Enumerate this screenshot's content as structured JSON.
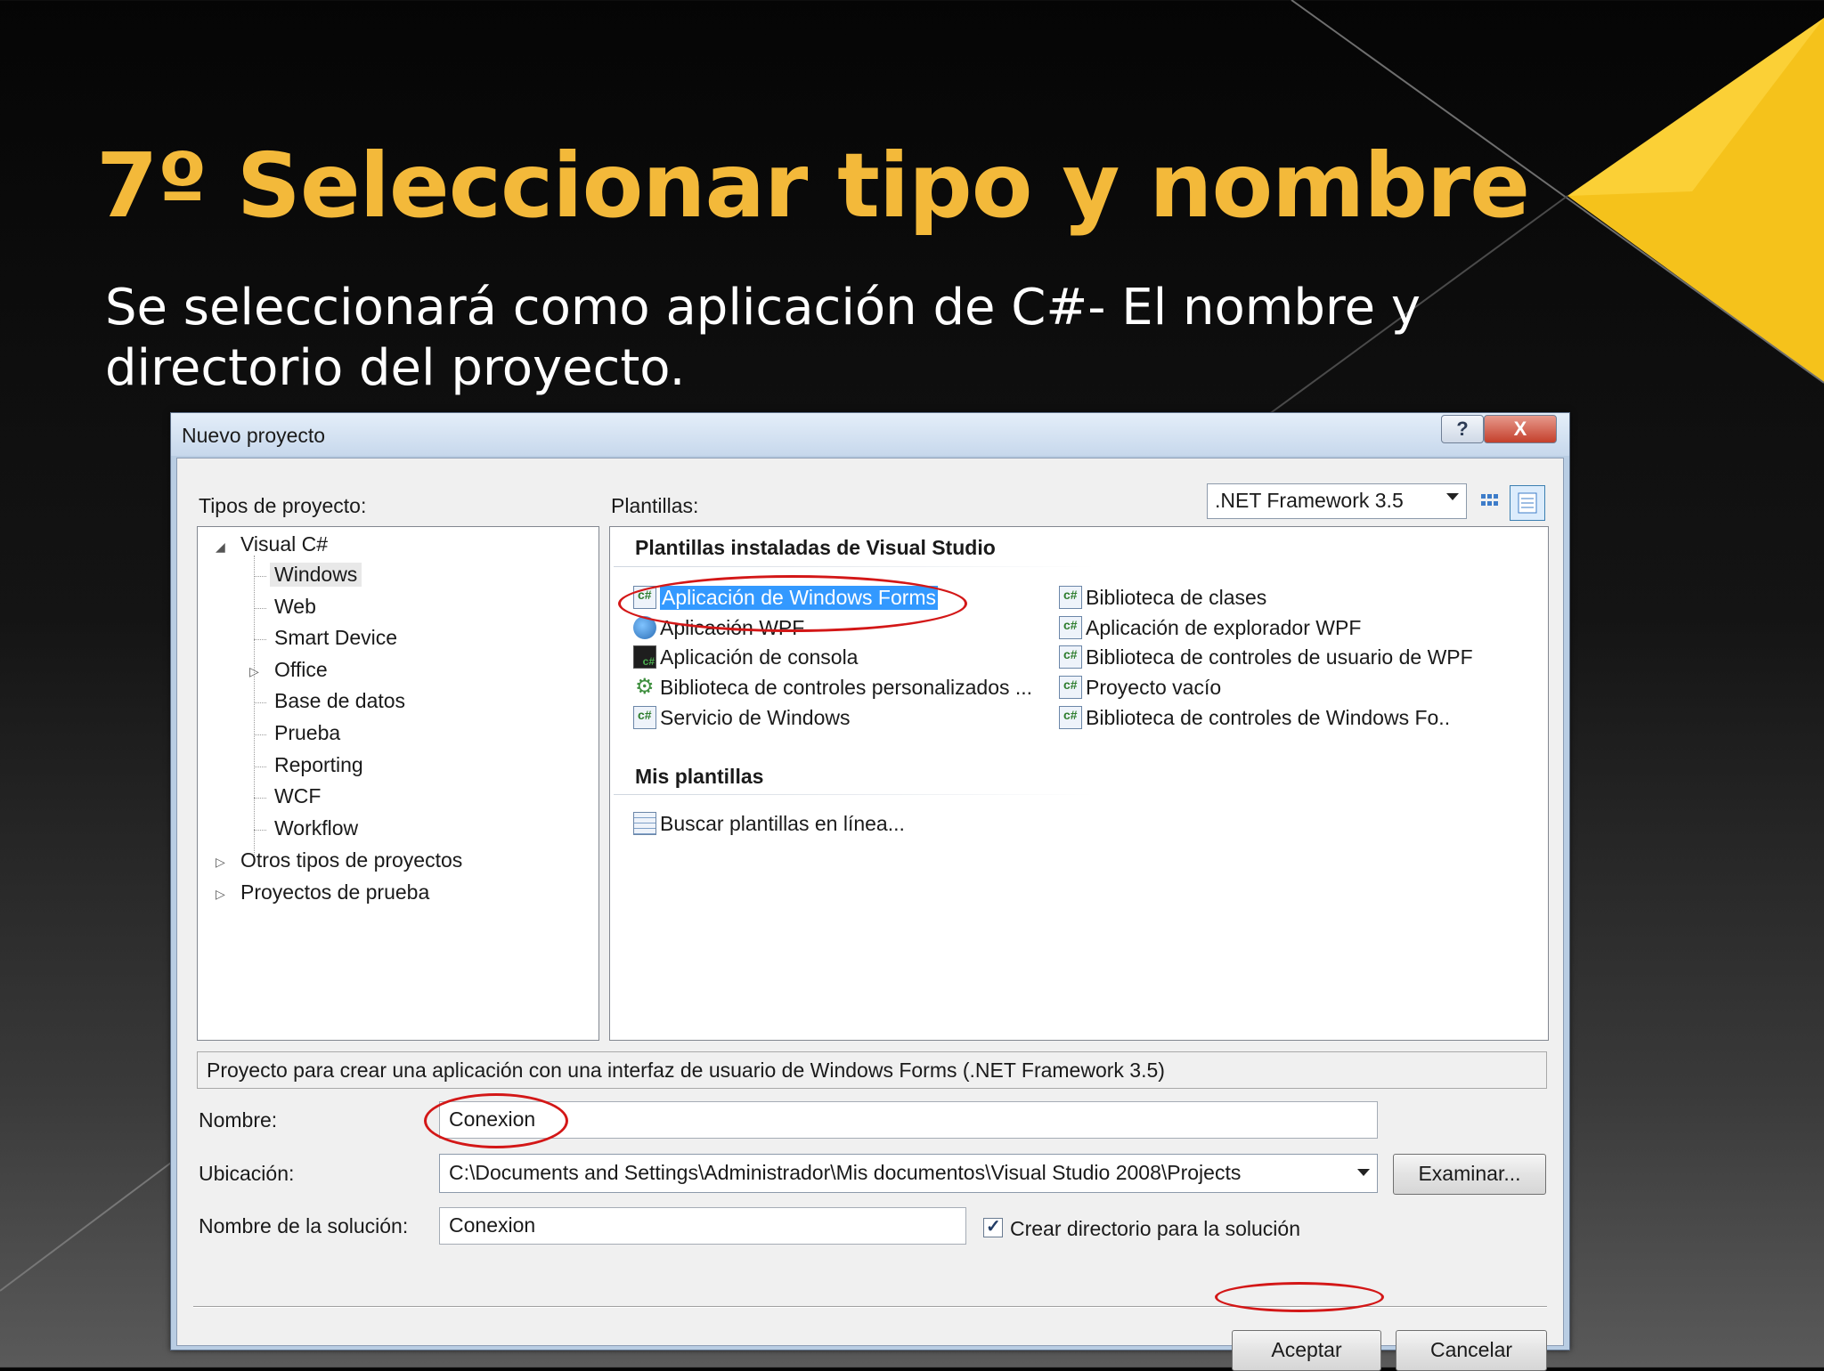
{
  "slide": {
    "title": "7º Seleccionar tipo y nombre",
    "subtitle": "Se seleccionará como aplicación de C#- El nombre  y directorio del proyecto."
  },
  "dialog": {
    "title": "Nuevo proyecto",
    "help_label": "?",
    "close_label": "X",
    "project_types_label": "Tipos de proyecto:",
    "templates_label": "Plantillas:",
    "framework": ".NET Framework 3.5",
    "tree": {
      "root": "Visual C#",
      "children": [
        "Windows",
        "Web",
        "Smart Device",
        "Office",
        "Base de datos",
        "Prueba",
        "Reporting",
        "WCF",
        "Workflow"
      ],
      "other": [
        "Otros tipos de proyectos",
        "Proyectos de prueba"
      ]
    },
    "installed_header": "Plantillas instaladas de Visual Studio",
    "installed_left": [
      "Aplicación de Windows Forms",
      "Aplicación WPF",
      "Aplicación de consola",
      "Biblioteca de controles personalizados ...",
      "Servicio de Windows"
    ],
    "installed_right": [
      "Biblioteca de clases",
      "Aplicación de explorador WPF",
      "Biblioteca de controles de usuario de WPF",
      "Proyecto vacío",
      "Biblioteca de controles de Windows Fo.."
    ],
    "my_templates_header": "Mis plantillas",
    "online_search": "Buscar plantillas en línea...",
    "description": "Proyecto para crear una aplicación con una interfaz de usuario de Windows Forms (.NET Framework 3.5)",
    "name_label": "Nombre:",
    "name_value": "Conexion",
    "location_label": "Ubicación:",
    "location_value": "C:\\Documents and Settings\\Administrador\\Mis documentos\\Visual Studio 2008\\Projects",
    "browse_button": "Examinar...",
    "solution_label": "Nombre de la solución:",
    "solution_value": "Conexion",
    "create_dir_label": "Crear directorio para la solución",
    "create_dir_checked": true,
    "ok_button": "Aceptar",
    "cancel_button": "Cancelar"
  },
  "colors": {
    "title_color": "#f3b93a",
    "selection": "#3399ff",
    "annotation_red": "#d31717"
  }
}
